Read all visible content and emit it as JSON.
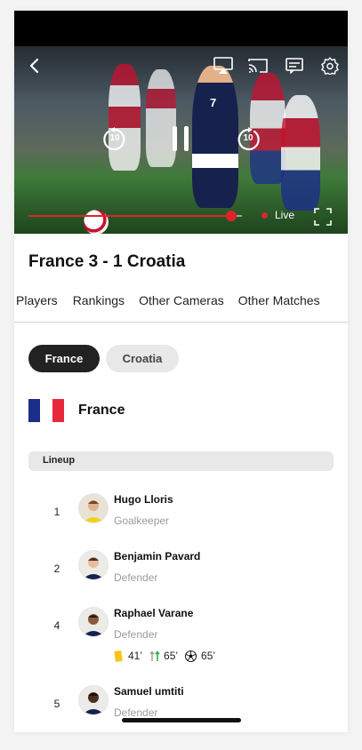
{
  "video": {
    "live_label": "Live",
    "progress": 0.95,
    "rewind_seconds": "10",
    "forward_seconds": "10",
    "jersey_number": "7"
  },
  "match": {
    "title": "France 3 - 1 Croatia"
  },
  "tabs": [
    {
      "label": "Players"
    },
    {
      "label": "Rankings"
    },
    {
      "label": "Other Cameras"
    },
    {
      "label": "Other Matches"
    }
  ],
  "team_toggle": {
    "selected": "France",
    "other": "Croatia"
  },
  "team": {
    "name": "France",
    "flag_colors": [
      "#1a2e8a",
      "#ffffff",
      "#e8283a"
    ]
  },
  "lineup": {
    "label": "Lineup",
    "players": [
      {
        "number": "1",
        "name": "Hugo Lloris",
        "position": "Goalkeeper"
      },
      {
        "number": "2",
        "name": "Benjamin Pavard",
        "position": "Defender"
      },
      {
        "number": "4",
        "name": "Raphael Varane",
        "position": "Defender",
        "events": {
          "yellow_card": "41’",
          "substitution": "65’",
          "goal": "65’"
        }
      },
      {
        "number": "5",
        "name": "Samuel umtiti",
        "position": "Defender"
      }
    ]
  },
  "colors": {
    "accent": "#e0232b",
    "dark": "#222222",
    "muted": "#9b9b9b"
  }
}
